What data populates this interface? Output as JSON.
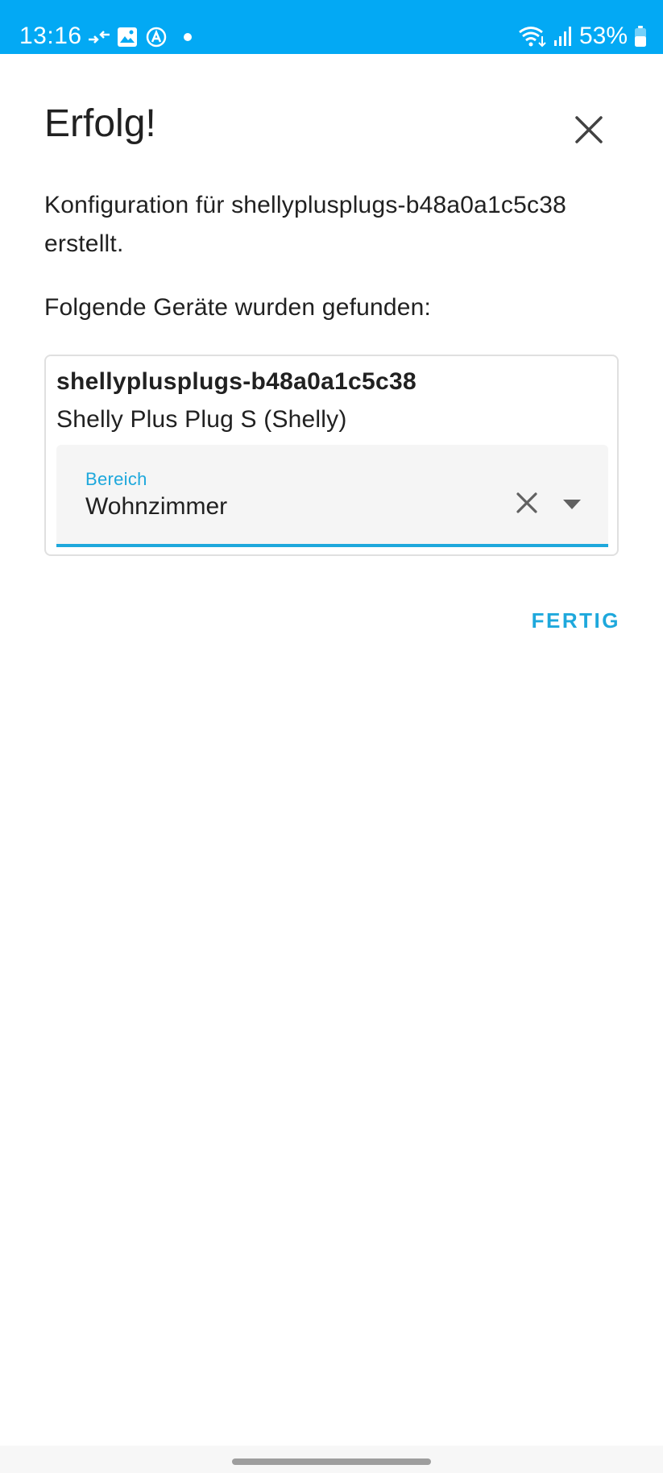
{
  "status_bar": {
    "time": "13:16",
    "battery": "53%",
    "icons": [
      "data-transfer-icon",
      "gallery-icon",
      "autodraw-icon",
      "notification-dot-icon",
      "wifi-icon",
      "signal-icon",
      "battery-icon"
    ]
  },
  "dialog": {
    "title": "Erfolg!",
    "message": "Konfiguration für shellyplusplugs-b48a0a1c5c38 erstellt.",
    "devices_found_label": "Folgende Geräte wurden gefunden:",
    "device": {
      "name": "shellyplusplugs-b48a0a1c5c38",
      "model": "Shelly Plus Plug S (Shelly)",
      "area": {
        "label": "Bereich",
        "value": "Wohnzimmer"
      }
    },
    "done_label": "FERTIG"
  },
  "colors": {
    "status_bar": "#03a9f4",
    "accent": "#1ea8dc",
    "text": "#212121",
    "field_bg": "#f5f5f5"
  }
}
